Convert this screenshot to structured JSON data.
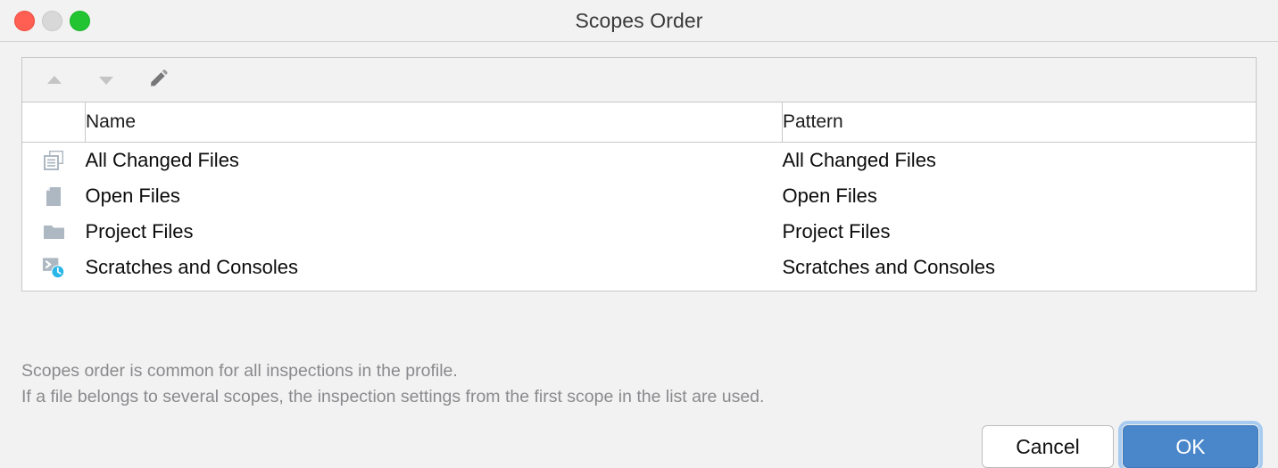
{
  "window": {
    "title": "Scopes Order",
    "traffic_lights": [
      {
        "name": "close-button",
        "color": "#ff5f52"
      },
      {
        "name": "minimize-button",
        "color": "#d8d8d8"
      },
      {
        "name": "zoom-button",
        "color": "#23c431"
      }
    ]
  },
  "toolbar": {
    "items": [
      {
        "icon": "move-up-icon",
        "label": "Move Up",
        "enabled": false
      },
      {
        "icon": "move-down-icon",
        "label": "Move Down",
        "enabled": false
      },
      {
        "icon": "edit-pencil-icon",
        "label": "Edit",
        "enabled": true
      }
    ]
  },
  "table": {
    "columns": [
      "",
      "Name",
      "Pattern"
    ],
    "rows": [
      {
        "icon": "changed-files-icon",
        "name": "All Changed Files",
        "pattern": "All Changed Files"
      },
      {
        "icon": "file-icon",
        "name": "Open Files",
        "pattern": "Open Files"
      },
      {
        "icon": "folder-icon",
        "name": "Project Files",
        "pattern": "Project Files"
      },
      {
        "icon": "scratches-consoles-icon",
        "name": "Scratches and Consoles",
        "pattern": "Scratches and Consoles"
      }
    ]
  },
  "note": {
    "line1": "Scopes order is common for all inspections in the profile.",
    "line2": "If a file belongs to several scopes, the inspection settings from the first scope in the list are used."
  },
  "buttons": {
    "cancel": "Cancel",
    "ok": "OK"
  },
  "colors": {
    "accent": "#4a87ca",
    "focus_ring": "#a8cbf0",
    "icon_gray": "#adb8c2",
    "badge_blue": "#29b6e8",
    "toolbar_enabled": "#77777a",
    "toolbar_disabled": "#c4c4c4"
  }
}
